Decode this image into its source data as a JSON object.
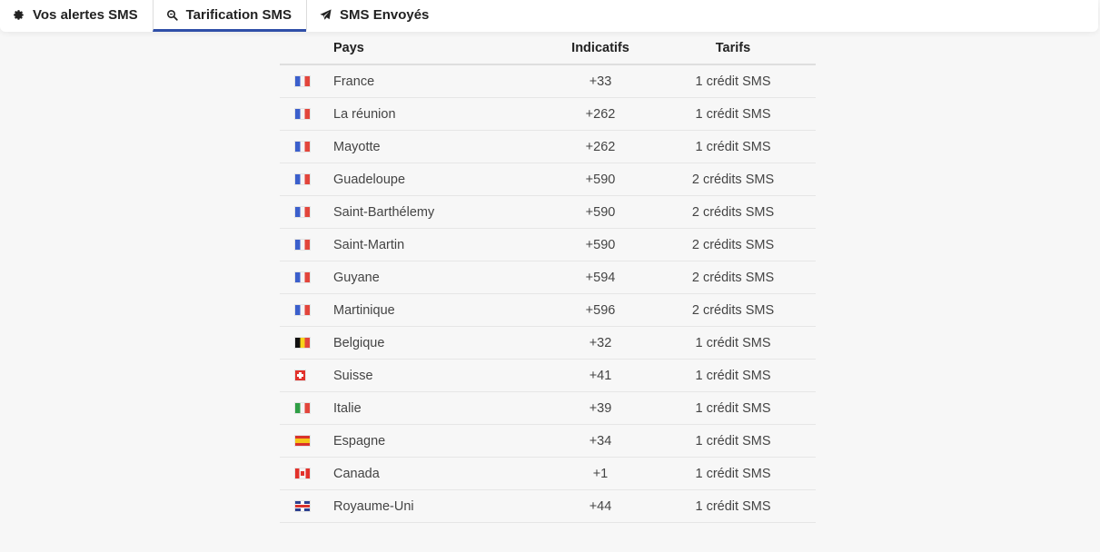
{
  "tabs": [
    {
      "label": "Vos alertes SMS",
      "icon": "gear-icon",
      "active": false
    },
    {
      "label": "Tarification SMS",
      "icon": "search-icon",
      "active": true
    },
    {
      "label": "SMS Envoyés",
      "icon": "paper-plane-icon",
      "active": false
    }
  ],
  "table": {
    "headers": {
      "flag": "",
      "pays": "Pays",
      "indicatifs": "Indicatifs",
      "tarifs": "Tarifs"
    },
    "rows": [
      {
        "flag": "fr",
        "pays": "France",
        "indicatif": "+33",
        "tarif": "1 crédit SMS"
      },
      {
        "flag": "fr",
        "pays": "La réunion",
        "indicatif": "+262",
        "tarif": "1 crédit SMS"
      },
      {
        "flag": "fr",
        "pays": "Mayotte",
        "indicatif": "+262",
        "tarif": "1 crédit SMS"
      },
      {
        "flag": "fr",
        "pays": "Guadeloupe",
        "indicatif": "+590",
        "tarif": "2 crédits SMS"
      },
      {
        "flag": "fr",
        "pays": "Saint-Barthélemy",
        "indicatif": "+590",
        "tarif": "2 crédits SMS"
      },
      {
        "flag": "fr",
        "pays": "Saint-Martin",
        "indicatif": "+590",
        "tarif": "2 crédits SMS"
      },
      {
        "flag": "fr",
        "pays": "Guyane",
        "indicatif": "+594",
        "tarif": "2 crédits SMS"
      },
      {
        "flag": "fr",
        "pays": "Martinique",
        "indicatif": "+596",
        "tarif": "2 crédits SMS"
      },
      {
        "flag": "be",
        "pays": "Belgique",
        "indicatif": "+32",
        "tarif": "1 crédit SMS"
      },
      {
        "flag": "ch",
        "pays": "Suisse",
        "indicatif": "+41",
        "tarif": "1 crédit SMS"
      },
      {
        "flag": "it",
        "pays": "Italie",
        "indicatif": "+39",
        "tarif": "1 crédit SMS"
      },
      {
        "flag": "es",
        "pays": "Espagne",
        "indicatif": "+34",
        "tarif": "1 crédit SMS"
      },
      {
        "flag": "ca",
        "pays": "Canada",
        "indicatif": "+1",
        "tarif": "1 crédit SMS"
      },
      {
        "flag": "gb",
        "pays": "Royaume-Uni",
        "indicatif": "+44",
        "tarif": "1 crédit SMS"
      }
    ]
  },
  "colors": {
    "accent": "#2f4fa8",
    "background": "#f7f7f7"
  }
}
